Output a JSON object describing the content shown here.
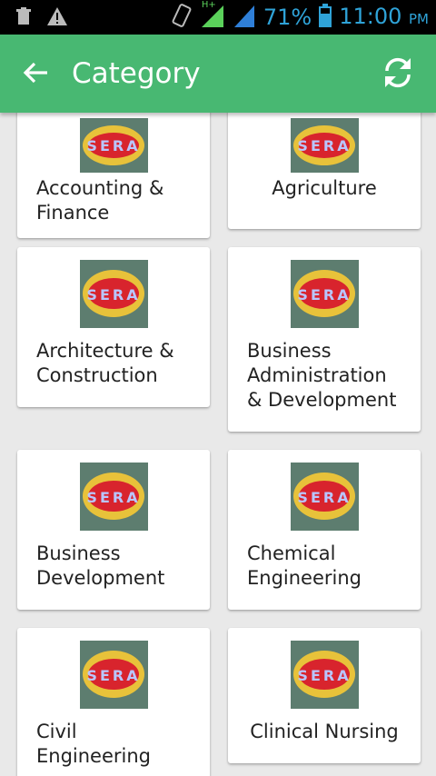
{
  "status_bar": {
    "battery": "71%",
    "time": "11:00",
    "ampm": "PM",
    "network": "H+"
  },
  "app_bar": {
    "title": "Category"
  },
  "logo_text": "SERA",
  "categories": [
    {
      "label": "Accounting & Finance"
    },
    {
      "label": "Agriculture"
    },
    {
      "label": "Architecture & Construction"
    },
    {
      "label": "Business Administration & Development"
    },
    {
      "label": "Business Development"
    },
    {
      "label": "Chemical Engineering"
    },
    {
      "label": "Civil Engineering"
    },
    {
      "label": "Clinical Nursing"
    }
  ],
  "colors": {
    "app_bar": "#48b872",
    "status_text": "#2fa3d8",
    "background": "#e9e9e9"
  }
}
